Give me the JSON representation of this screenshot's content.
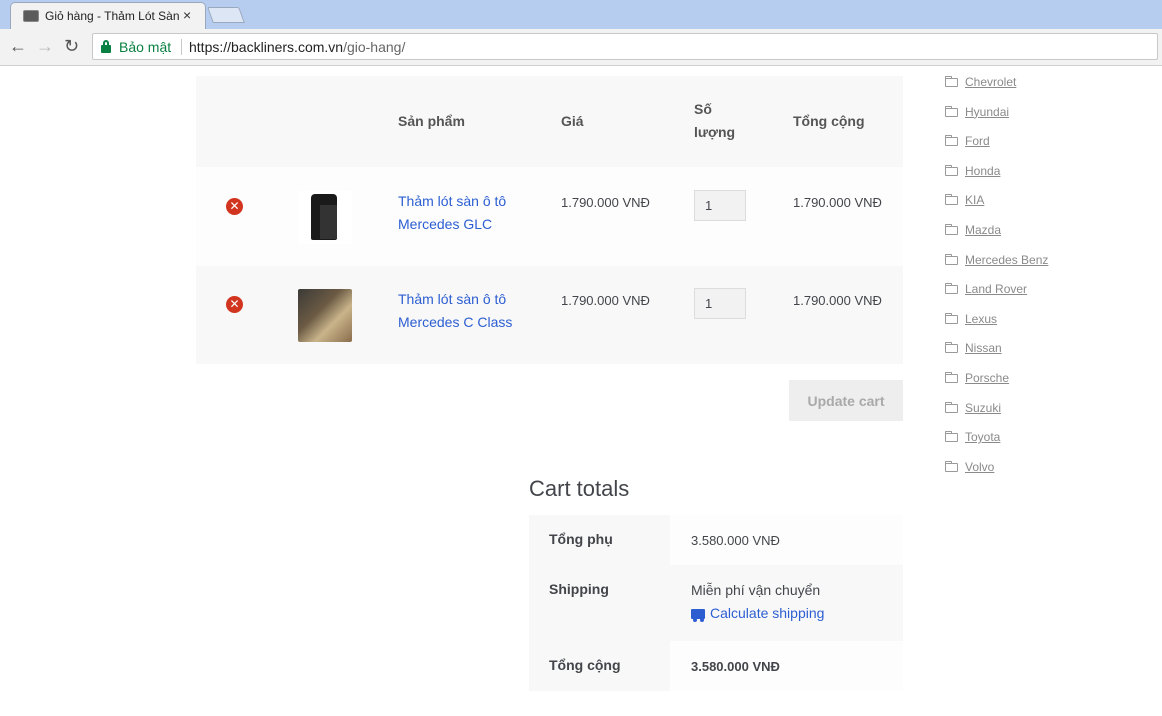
{
  "browser": {
    "tab_title": "Giỏ hàng - Thảm Lót Sàn",
    "tab_close": "×",
    "secure_label": "Bảo mật",
    "url_host": "https://backliners.com.vn",
    "url_path": "/gio-hang/"
  },
  "cart": {
    "headers": {
      "product": "Sản phẩm",
      "price": "Giá",
      "qty_line1": "Số",
      "qty_line2": "lượng",
      "total": "Tổng cộng"
    },
    "items": [
      {
        "name_line1": "Thảm lót sàn ô tô",
        "name_line2": "Mercedes GLC",
        "price": "1.790.000 VNĐ",
        "quantity": "1",
        "total": "1.790.000 VNĐ"
      },
      {
        "name_line1": "Thảm lót sàn ô tô",
        "name_line2": "Mercedes C Class",
        "price": "1.790.000 VNĐ",
        "quantity": "1",
        "total": "1.790.000 VNĐ"
      }
    ],
    "update_label": "Update cart"
  },
  "totals": {
    "title": "Cart totals",
    "subtotal_label": "Tổng phụ",
    "subtotal_value": "3.580.000 VNĐ",
    "shipping_label": "Shipping",
    "shipping_value": "Miễn phí vận chuyển",
    "calc_shipping": "Calculate shipping",
    "total_label": "Tổng cộng",
    "total_value": "3.580.000 VNĐ"
  },
  "sidebar": {
    "categories": [
      "Chevrolet",
      "Hyundai",
      "Ford",
      "Honda",
      "KIA",
      "Mazda",
      "Mercedes Benz",
      "Land Rover",
      "Lexus",
      "Nissan",
      "Porsche",
      "Suzuki",
      "Toyota",
      "Volvo"
    ]
  },
  "colors": {
    "link": "#2c5ed2",
    "remove": "#d2351f",
    "secure": "#0b8043"
  }
}
